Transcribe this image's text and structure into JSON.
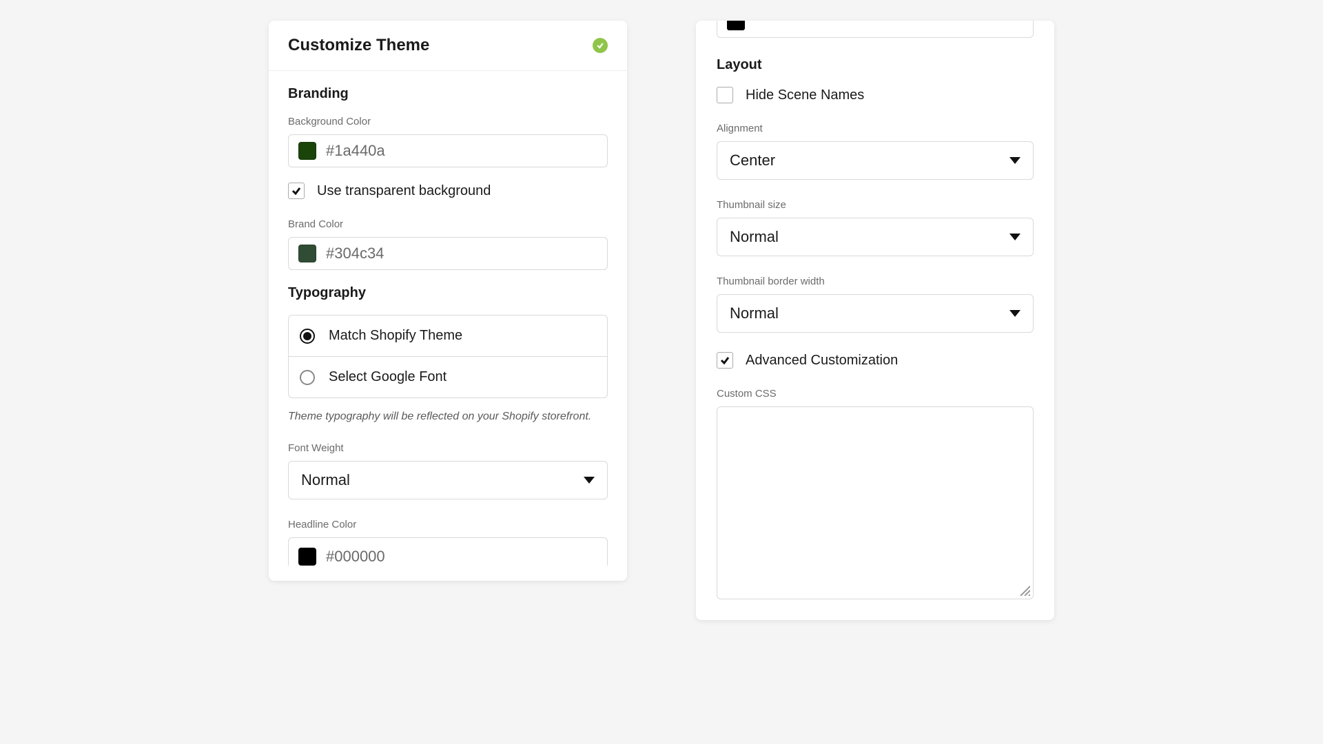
{
  "left": {
    "title": "Customize Theme",
    "branding": {
      "title": "Branding",
      "bg_label": "Background Color",
      "bg_value": "#1a440a",
      "bg_swatch": "#1a440a",
      "transparent_label": "Use transparent background",
      "transparent_checked": true,
      "brand_label": "Brand Color",
      "brand_value": "#304c34",
      "brand_swatch": "#304c34"
    },
    "typography": {
      "title": "Typography",
      "match_label": "Match Shopify Theme",
      "google_label": "Select Google Font",
      "note": "Theme typography will be reflected on your Shopify storefront.",
      "weight_label": "Font Weight",
      "weight_value": "Normal",
      "headline_label": "Headline Color",
      "headline_value": "#000000",
      "headline_swatch": "#000000"
    }
  },
  "right": {
    "top_cut_swatch": "#000000",
    "layout": {
      "title": "Layout",
      "hide_label": "Hide Scene Names",
      "hide_checked": false,
      "align_label": "Alignment",
      "align_value": "Center",
      "thumb_label": "Thumbnail size",
      "thumb_value": "Normal",
      "border_label": "Thumbnail border width",
      "border_value": "Normal",
      "advanced_label": "Advanced Customization",
      "advanced_checked": true,
      "css_label": "Custom CSS"
    }
  }
}
